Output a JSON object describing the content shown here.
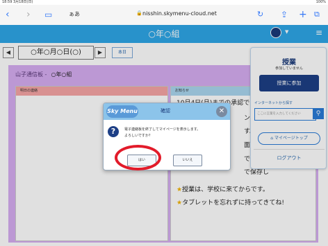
{
  "status_bar": {
    "time": "18:59 3月18日(日)",
    "battery": "100%"
  },
  "browser": {
    "aa_label": "ぁあ",
    "url": "nisshin.skymenu-cloud.net"
  },
  "app": {
    "title": "○年○組"
  },
  "date_nav": {
    "date": "○年○月○日(○)",
    "today_label": "本日"
  },
  "board": {
    "title": "山子通信板 -",
    "class_name": "○年○組",
    "left_header": "明日の連絡",
    "right_header": "お知らせ",
    "notices": [
      "10月4日(月)までの承認です。",
      "ンしま",
      "す。",
      "面してい",
      "です。",
      "で保存し",
      "授業は、学校に来てからです。",
      "タブレットを忘れずに持ってきてね!"
    ]
  },
  "popup": {
    "title": "授業",
    "status": "参加していません",
    "join_button": "授業に参加",
    "link_label": "インターネットから探す",
    "search_placeholder": "ここに言葉を入力してください",
    "mypage_button": "マイページトップ",
    "logout_button": "ログアウト"
  },
  "dialog": {
    "logo": "Sky Menu",
    "title": "確認",
    "message_line1": "電子連絡板を終了してマイページを表示します。",
    "message_line2": "よろしいですか?",
    "yes_button": "はい",
    "no_button": "いいえ"
  },
  "colors": {
    "app_bar": "#2ea7e8",
    "board_bg": "#d7aef2",
    "join_button": "#1d3f86",
    "highlight_ring": "#e21b2a"
  }
}
